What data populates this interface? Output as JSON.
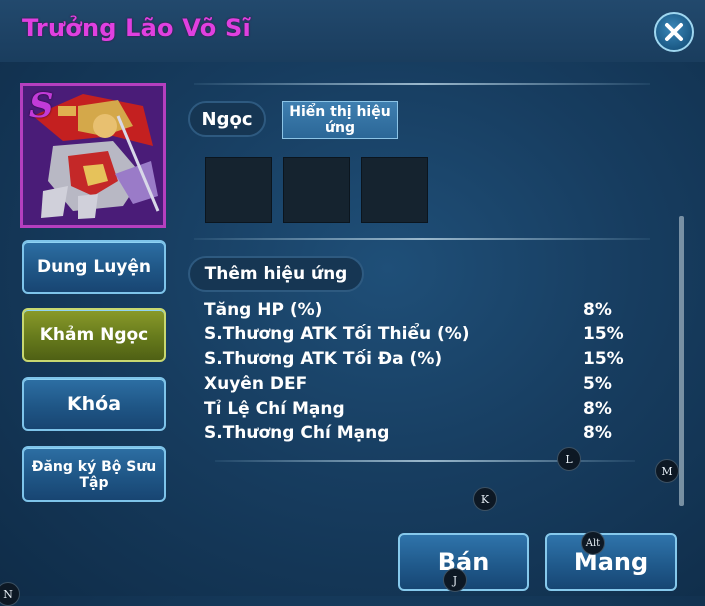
{
  "window": {
    "title": "Trưởng Lão Võ Sĩ"
  },
  "hero": {
    "rank_letter": "S"
  },
  "side_buttons": [
    {
      "label": "Dung Luyện",
      "active": false
    },
    {
      "label": "Khảm Ngọc",
      "active": true
    },
    {
      "label": "Khóa",
      "active": false
    },
    {
      "label": "Đăng ký Bộ Sưu Tập",
      "active": false
    }
  ],
  "gems": {
    "label": "Ngọc",
    "toggle_label": "Hiển thị hiệu ứng",
    "slot_count": 3
  },
  "effects": {
    "label": "Thêm hiệu ứng",
    "stats": [
      {
        "name": "Tăng HP (%)",
        "value": "8%"
      },
      {
        "name": "S.Thương ATK Tối Thiểu (%)",
        "value": "15%"
      },
      {
        "name": "S.Thương ATK Tối Đa (%)",
        "value": "15%"
      },
      {
        "name": "Xuyên DEF",
        "value": "5%"
      },
      {
        "name": "Tỉ Lệ Chí Mạng",
        "value": "8%"
      },
      {
        "name": "S.Thương Chí Mạng",
        "value": "8%"
      }
    ]
  },
  "actions": {
    "sell_label": "Bán",
    "carry_label": "Mang"
  },
  "key_hints": {
    "l": "L",
    "m": "M",
    "k": "K",
    "alt": "Alt",
    "j": "J",
    "n": "N"
  },
  "colors": {
    "title": "#e040e0",
    "active_button": "#7a8c22",
    "button": "#235f92"
  }
}
